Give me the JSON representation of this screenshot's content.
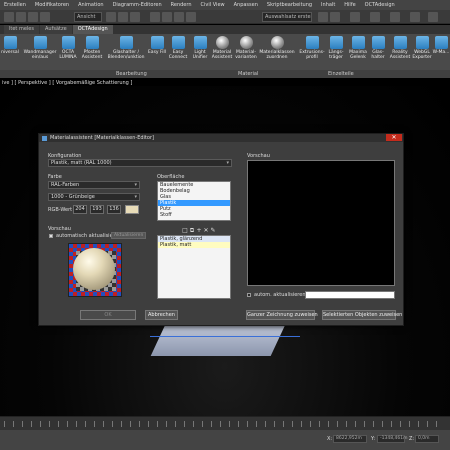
{
  "menubar": {
    "items": [
      "Erstellen",
      "Modifikatoren",
      "Animation",
      "Diagramm-Editoren",
      "Rendern",
      "Civil View",
      "Anpassen",
      "Skriptbearbeitung",
      "Inhalt",
      "Hilfe",
      "OCTAdesign"
    ]
  },
  "toolbar": {
    "view_dropdown": "Ansicht",
    "selection_set": "Auswahlsatz erstelle"
  },
  "tabs": [
    "ltet meles",
    "Aufsätze",
    "OCTAdesign"
  ],
  "ribbon": {
    "buttons": [
      "niversal",
      "Wandmanager ein/aus",
      "OCTA LUMINA",
      "Pfosten Assistent",
      "Glashalter / Blenden/unktion",
      "Easy Fill",
      "Easy Connect",
      "Light Unifier",
      "Material Assistent",
      "Material-varianten",
      "Materialklassen zuordnen",
      "Extrusions-profil",
      "Längs-träger",
      "Maxima Gelenk",
      "Glas-halter",
      "Reality Assistent",
      "WebGL Exporter",
      "W-Ma..."
    ],
    "groups": [
      "Bearbeitung",
      "Material",
      "Einzelteile"
    ]
  },
  "viewport": {
    "title": "ive ] [ Perspektive ] [ Vorgabemäßige Schattierung ]"
  },
  "dialog": {
    "title": "Materialassistent [Materialklassen-Editor]",
    "configurator_label": "Konfiguration",
    "configurator_value": "Plastik, matt (RAL 1000)",
    "color_label": "Farbe",
    "color_system": "RAL-Farben",
    "color_value": "1000 - Grünbeige",
    "rgb_label": "RGB-Wert",
    "rgb": {
      "r": "204",
      "g": "193",
      "b": "136"
    },
    "surface_label": "Oberfläche",
    "surfaces": [
      "Bauelemente",
      "Bodenbelag",
      "Glas",
      "Plastik",
      "Putz",
      "Stoff"
    ],
    "surface_selected_index": 3,
    "materials": [
      "Plastik, glänzend",
      "Plastik, matt"
    ],
    "material_selected_index": 1,
    "preview_label": "Vorschau",
    "auto_update_label": "automatisch aktualisieren",
    "update_button": "Aktualisieren",
    "right_preview_label": "Vorschau",
    "right_auto_update_label": "autom. aktualisieren",
    "ok_button": "OK",
    "cancel_button": "Abbrechen",
    "assign_all_button": "Ganzer Zeichnung zuweisen",
    "assign_selected_button": "Selektierten Objekten zuweisen"
  },
  "statusbar": {
    "x_label": "X:",
    "x": "8622,952m",
    "y_label": "Y:",
    "y": "-1348,461m",
    "z_label": "Z:",
    "z": "0,0m"
  }
}
